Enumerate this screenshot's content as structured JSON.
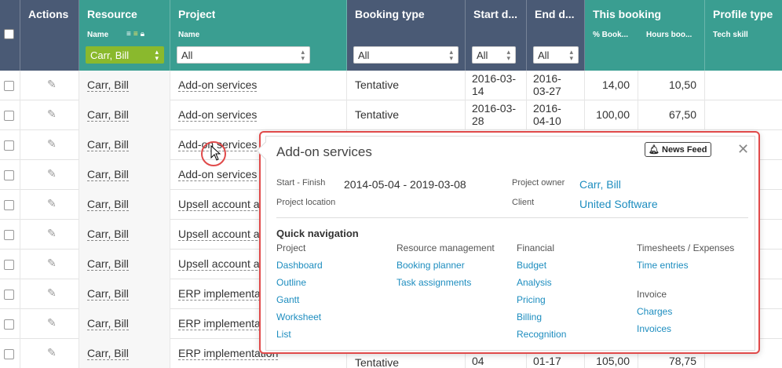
{
  "header": {
    "actions": "Actions",
    "resource": "Resource",
    "resource_sub": "Name",
    "resource_filter": "Carr, Bill",
    "project": "Project",
    "project_sub": "Name",
    "project_filter": "All",
    "booking_type": "Booking type",
    "booking_filter": "All",
    "start": "Start d...",
    "start_filter": "All",
    "end": "End d...",
    "end_filter": "All",
    "this_booking": "This booking",
    "pct_booked": "% Book...",
    "hours_booked": "Hours boo...",
    "profile_type": "Profile type",
    "tech_skill": "Tech skill"
  },
  "rows": [
    {
      "resource": "Carr, Bill",
      "project": "Add-on services",
      "type": "Tentative",
      "start1": "2016-03-",
      "start2": "14",
      "end1": "2016-",
      "end2": "03-27",
      "pct": "14,00",
      "hours": "10,50"
    },
    {
      "resource": "Carr, Bill",
      "project": "Add-on services",
      "type": "Tentative",
      "start1": "2016-03-",
      "start2": "28",
      "end1": "2016-",
      "end2": "04-10",
      "pct": "100,00",
      "hours": "67,50"
    },
    {
      "resource": "Carr, Bill",
      "project": "Add-on services"
    },
    {
      "resource": "Carr, Bill",
      "project": "Add-on services"
    },
    {
      "resource": "Carr, Bill",
      "project": "Upsell account au"
    },
    {
      "resource": "Carr, Bill",
      "project": "Upsell account au"
    },
    {
      "resource": "Carr, Bill",
      "project": "Upsell account au"
    },
    {
      "resource": "Carr, Bill",
      "project": "ERP implementatio"
    },
    {
      "resource": "Carr, Bill",
      "project": "ERP implementatio"
    },
    {
      "resource": "Carr, Bill",
      "project": "ERP implementation",
      "type": "Tentative",
      "start2": "04",
      "end2": "01-17",
      "pct": "105,00",
      "hours": "78,75"
    }
  ],
  "popup": {
    "title": "Add-on services",
    "news_feed": "News Feed",
    "close": "✕",
    "start_finish_label": "Start - Finish",
    "start_finish": "2014-05-04 - 2019-03-08",
    "location_label": "Project location",
    "owner_label": "Project owner",
    "owner": "Carr, Bill",
    "client_label": "Client",
    "client": "United Software",
    "quick_nav": "Quick navigation",
    "col_project": "Project",
    "col_resource": "Resource management",
    "col_financial": "Financial",
    "col_timesheets": "Timesheets / Expenses",
    "col_invoice": "Invoice",
    "project_links": [
      "Dashboard",
      "Outline",
      "Gantt",
      "Worksheet",
      "List"
    ],
    "resource_links": [
      "Booking planner",
      "Task assignments"
    ],
    "financial_links": [
      "Budget",
      "Analysis",
      "Pricing",
      "Billing",
      "Recognition"
    ],
    "timesheet_links": [
      "Time entries"
    ],
    "invoice_links": [
      "Charges",
      "Invoices"
    ]
  }
}
